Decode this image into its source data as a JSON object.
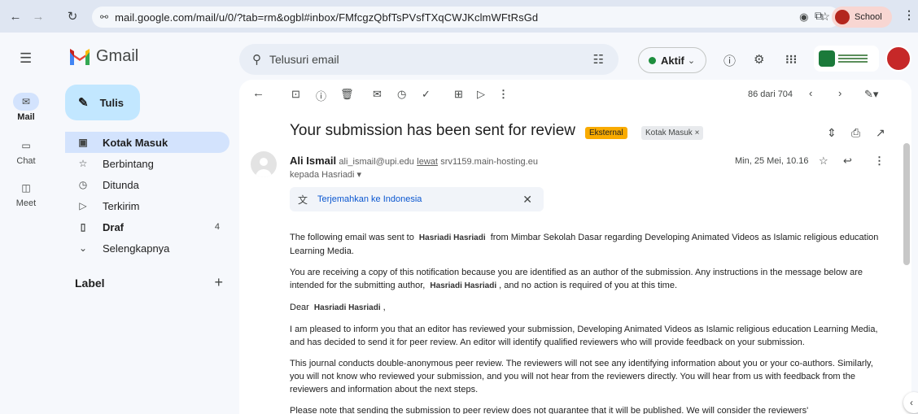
{
  "browser": {
    "url": "mail.google.com/mail/u/0/?tab=rm&ogbl#inbox/FMfcgzQbfTsPVsfTXqCWJKclmWFtRsGd",
    "profile_name": "School"
  },
  "header": {
    "app_name": "Gmail",
    "search_placeholder": "Telusuri email",
    "status": "Aktif"
  },
  "rail": [
    {
      "label": "Mail"
    },
    {
      "label": "Chat"
    },
    {
      "label": "Meet"
    }
  ],
  "compose_label": "Tulis",
  "nav": [
    {
      "label": "Kotak Masuk",
      "count": ""
    },
    {
      "label": "Berbintang",
      "count": ""
    },
    {
      "label": "Ditunda",
      "count": ""
    },
    {
      "label": "Terkirim",
      "count": ""
    },
    {
      "label": "Draf",
      "count": "4"
    },
    {
      "label": "Selengkapnya",
      "count": ""
    }
  ],
  "label_heading": "Label",
  "toolbar": {
    "pager": "86 dari 704"
  },
  "message": {
    "subject": "Your submission has been sent for review",
    "badge_external": "Eksternal",
    "badge_inbox": "Kotak Masuk ×",
    "sender_name": "Ali Ismail",
    "sender_email": "ali_ismail@upi.edu",
    "via_label": "lewat",
    "via_host": "srv1159.main-hosting.eu",
    "to_line": "kepada Hasriadi ▾",
    "date": "Min, 25 Mei, 10.16",
    "translate_label": "Terjemahkan ke Indonesia",
    "p1_a": "The following email was sent to",
    "p1_name": "Hasriadi Hasriadi",
    "p1_b": "from Mimbar Sekolah Dasar regarding Developing Animated Videos as Islamic religious education Learning Media.",
    "p2_a": "You are receiving a copy of this notification because you are identified as an author of the submission. Any instructions in the message below are intended for the submitting author,",
    "p2_name": "Hasriadi Hasriadi",
    "p2_b": ", and no action is required of you at this time.",
    "p3_a": "Dear",
    "p3_name": "Hasriadi Hasriadi",
    "p3_b": ",",
    "p4": "I am pleased to inform you that an editor has reviewed your submission, Developing Animated Videos as Islamic religious education Learning Media, and has decided to send it for peer review. An editor will identify qualified reviewers who will provide feedback on your submission.",
    "p5": "This journal conducts double-anonymous peer review. The reviewers will not see any identifying information about you or your co-authors. Similarly, you will not know who reviewed your submission, and you will not hear from the reviewers directly. You will hear from us with feedback from the reviewers and information about the next steps.",
    "p6": "Please note that sending the submission to peer review does not guarantee that it will be published. We will consider the reviewers'"
  }
}
